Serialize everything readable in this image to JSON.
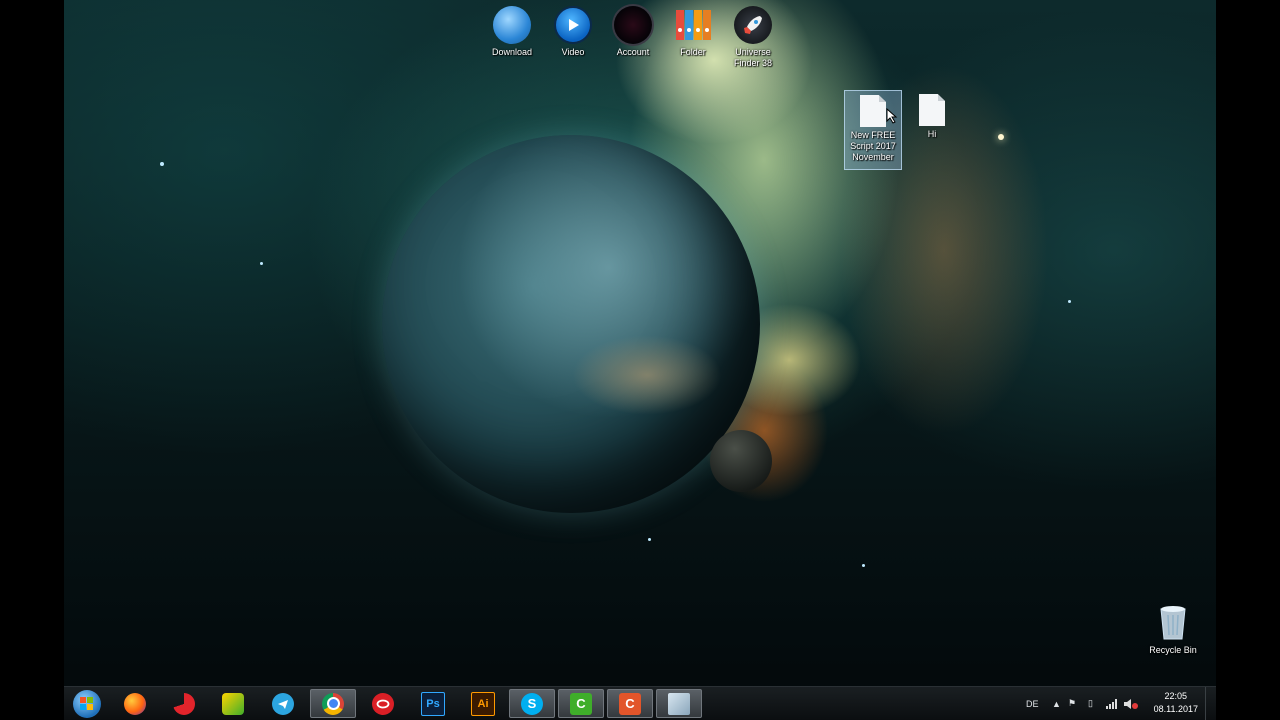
{
  "desktop": {
    "top_icons": [
      {
        "label": "Download",
        "icon": "globe-shortcut-icon"
      },
      {
        "label": "Video",
        "icon": "play-icon"
      },
      {
        "label": "Account",
        "icon": "dark-orb-icon"
      },
      {
        "label": "Folder",
        "icon": "binders-icon"
      },
      {
        "label": "Universe Finder 38",
        "icon": "rocket-icon"
      }
    ],
    "files": [
      {
        "label": "New FREE Script 2017 November",
        "icon": "text-file-icon",
        "selected": true
      },
      {
        "label": "Hi",
        "icon": "text-file-icon",
        "selected": false
      }
    ],
    "recycle_bin": {
      "label": "Recycle Bin",
      "icon": "recycle-bin-icon"
    }
  },
  "taskbar": {
    "apps": [
      {
        "name": "Start",
        "icon": "windows-start-icon"
      },
      {
        "name": "Firefox",
        "icon": "firefox-icon"
      },
      {
        "name": "CCleaner",
        "icon": "ccleaner-icon"
      },
      {
        "name": "Camtasia",
        "icon": "camtasia-icon"
      },
      {
        "name": "Telegram",
        "icon": "telegram-icon"
      },
      {
        "name": "Chrome",
        "icon": "chrome-icon"
      },
      {
        "name": "Creative Cloud",
        "icon": "creative-cloud-icon"
      },
      {
        "name": "Photoshop",
        "icon": "photoshop-icon",
        "text": "Ps"
      },
      {
        "name": "Illustrator",
        "icon": "illustrator-icon",
        "text": "Ai"
      },
      {
        "name": "Skype",
        "icon": "skype-icon",
        "text": "S"
      },
      {
        "name": "Camtasia Studio",
        "icon": "camtasia-studio-icon",
        "text": "C"
      },
      {
        "name": "App",
        "icon": "app-c-icon",
        "text": "C"
      },
      {
        "name": "Explorer",
        "icon": "explorer-icon"
      }
    ],
    "language": "DE",
    "time": "22:05",
    "date": "08.11.2017"
  },
  "colors": {
    "ps": "#0b1f3a",
    "ai": "#3a1a00",
    "skype": "#00aff0",
    "camtasia": "#3fae2a",
    "app_c": "#e2552a"
  }
}
